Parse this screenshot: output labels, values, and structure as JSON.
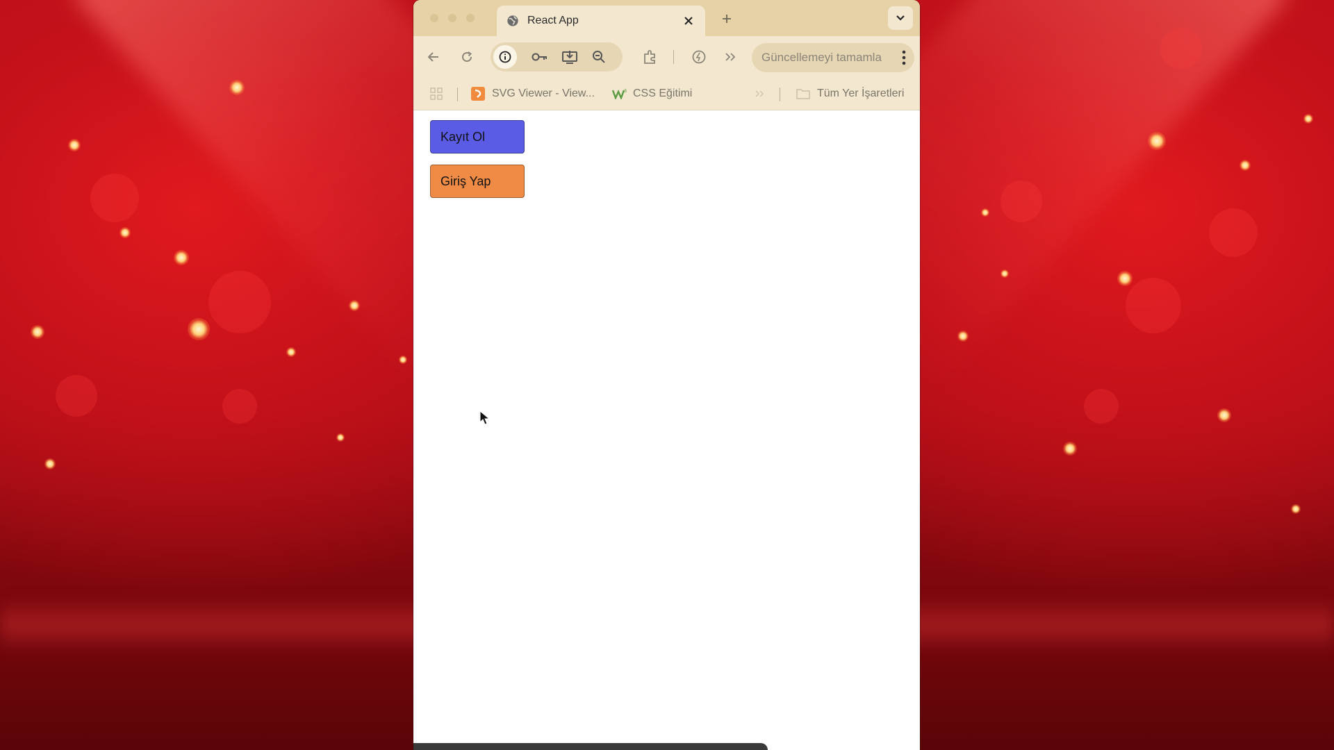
{
  "background": {
    "colors": {
      "main": "#b80f17",
      "dark": "#5a0508",
      "sparkle": "#ffd27a"
    }
  },
  "browser": {
    "tab": {
      "title": "React App",
      "icon": "globe-icon",
      "close_icon": "close-icon"
    },
    "toolbar": {
      "icons": [
        "back-arrow-icon",
        "reload-icon",
        "info-icon",
        "key-icon",
        "install-app-icon",
        "zoom-out-icon",
        "extensions-icon",
        "sync-icon",
        "more-chevrons-icon"
      ],
      "update_button_label": "Güncellemeyi tamamla"
    },
    "bookmarks": {
      "items": [
        {
          "label": "SVG Viewer - View...",
          "icon": "svg-viewer-favicon"
        },
        {
          "label": "CSS Eğitimi",
          "icon": "w3-favicon"
        }
      ],
      "all_bookmarks_label": "Tüm Yer İşaretleri"
    }
  },
  "page": {
    "buttons": {
      "register_label": "Kayıt Ol",
      "login_label": "Giriş Yap"
    },
    "colors": {
      "register": "#5b5ce6",
      "login": "#ef8b45"
    }
  }
}
